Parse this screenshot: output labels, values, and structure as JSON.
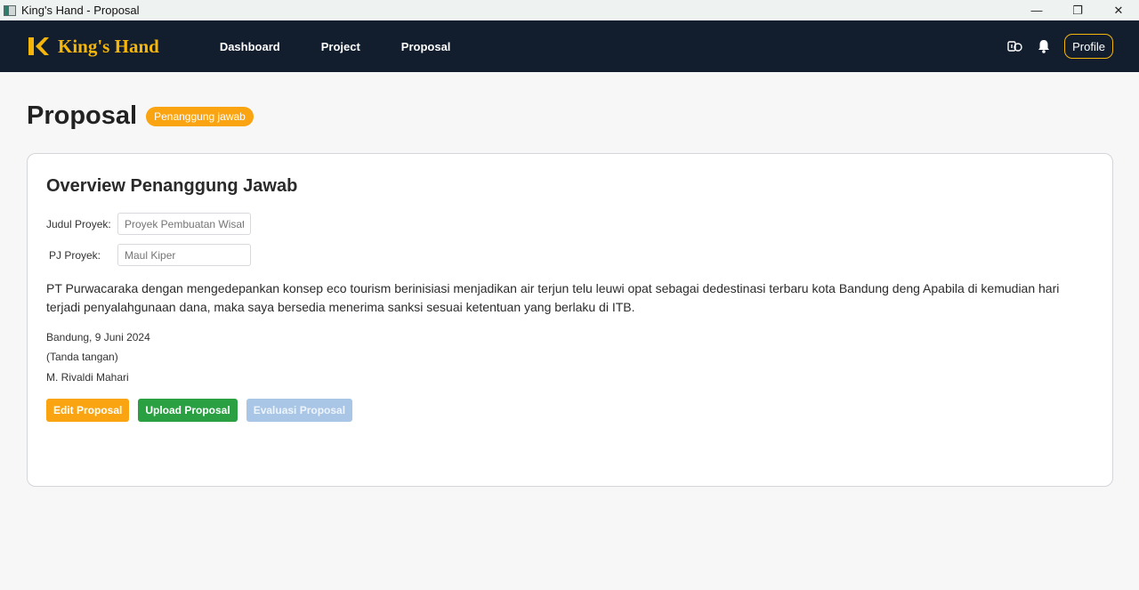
{
  "window": {
    "title": "King's Hand - Proposal",
    "controls": {
      "minimize": "—",
      "restore": "❐",
      "close": "✕"
    }
  },
  "navbar": {
    "brand": "King's Hand",
    "links": [
      "Dashboard",
      "Project",
      "Proposal"
    ],
    "profile_label": "Profile",
    "icons": [
      "theme-toggle-icon",
      "bell-icon"
    ],
    "accent_color": "#f5b50a",
    "background_color": "#121e2e"
  },
  "page": {
    "title": "Proposal",
    "badge": "Penanggung jawab"
  },
  "card": {
    "title": "Overview Penanggung Jawab",
    "fields": {
      "judul_label": "Judul Proyek:",
      "judul_placeholder": "Proyek Pembuatan Wisata",
      "pj_label": "PJ Proyek:",
      "pj_placeholder": "Maul Kiper"
    },
    "statement": "PT Purwacaraka dengan mengedepankan konsep eco tourism berinisiasi menjadikan air terjun telu leuwi opat sebagai dedestinasi terbaru kota Bandung deng Apabila di kemudian hari terjadi penyalahgunaan dana, maka saya bersedia menerima sanksi sesuai ketentuan yang berlaku di ITB.",
    "date_place": "Bandung, 9 Juni 2024",
    "signature_note": "(Tanda tangan)",
    "signer": "M. Rivaldi Mahari",
    "buttons": {
      "edit": "Edit Proposal",
      "upload": "Upload Proposal",
      "evaluate": "Evaluasi Proposal"
    }
  },
  "colors": {
    "badge_orange": "#f9a410",
    "upload_green": "#2aa043",
    "evaluate_disabled_blue": "#a9c6e6"
  }
}
